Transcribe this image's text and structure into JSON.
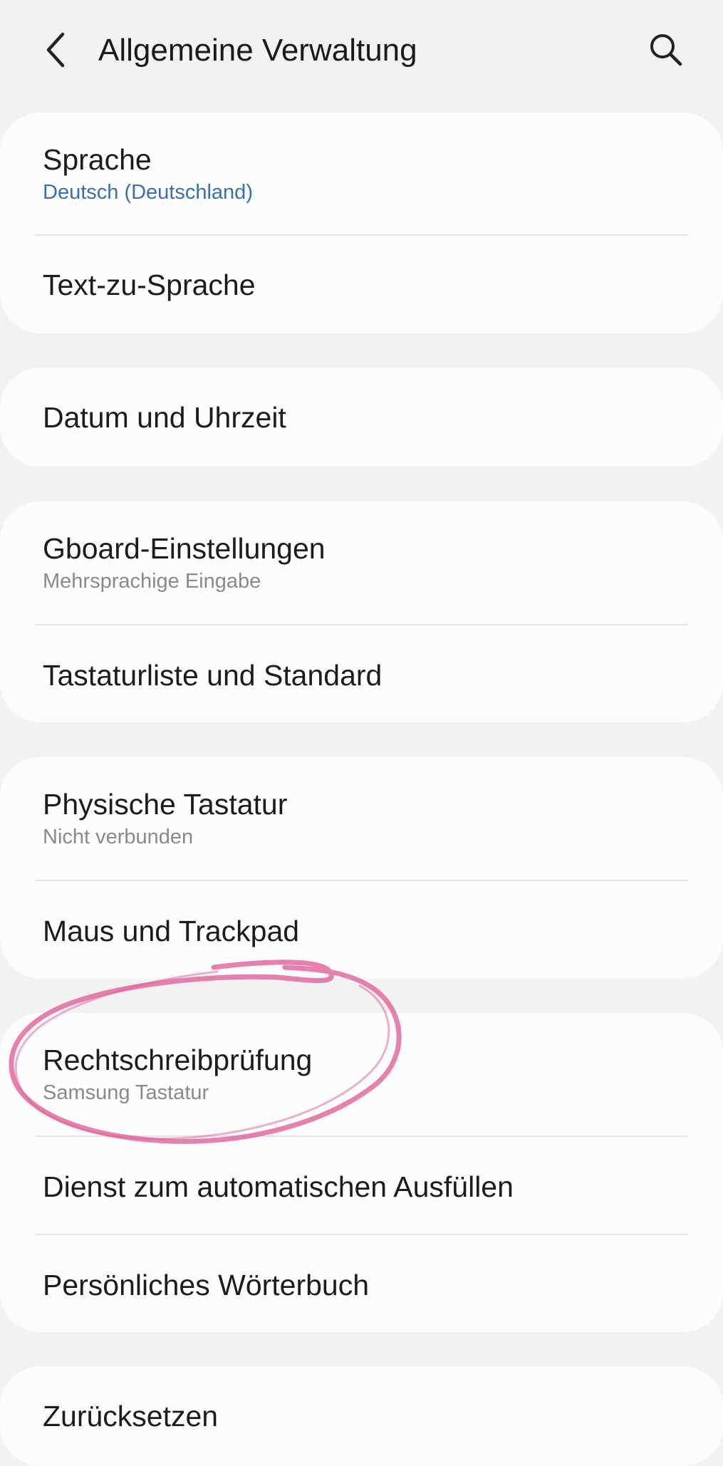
{
  "header": {
    "title": "Allgemeine Verwaltung",
    "back_icon": "chevron-left-icon",
    "search_icon": "search-icon"
  },
  "colors": {
    "background": "#f2f2f2",
    "card": "#fcfcfc",
    "accent_subtitle": "#3a6fb0",
    "annotation_stroke": "#e0609a"
  },
  "groups": [
    {
      "items": [
        {
          "title": "Sprache",
          "subtitle": "Deutsch (Deutschland)"
        },
        {
          "title": "Text-zu-Sprache"
        }
      ]
    },
    {
      "items": [
        {
          "title": "Datum und Uhrzeit"
        }
      ]
    },
    {
      "items": [
        {
          "title": "Gboard-Einstellungen",
          "subtitle": "Mehrsprachige Eingabe"
        },
        {
          "title": "Tastaturliste und Standard"
        }
      ]
    },
    {
      "items": [
        {
          "title": "Physische Tastatur",
          "subtitle": "Nicht verbunden"
        },
        {
          "title": "Maus und Trackpad"
        }
      ]
    },
    {
      "items": [
        {
          "title": "Rechtschreibprüfung",
          "subtitle": "Samsung Tastatur"
        },
        {
          "title": "Dienst zum automatischen Ausfüllen"
        },
        {
          "title": "Persönliches Wörterbuch"
        }
      ]
    },
    {
      "items": [
        {
          "title": "Zurücksetzen"
        }
      ]
    }
  ]
}
